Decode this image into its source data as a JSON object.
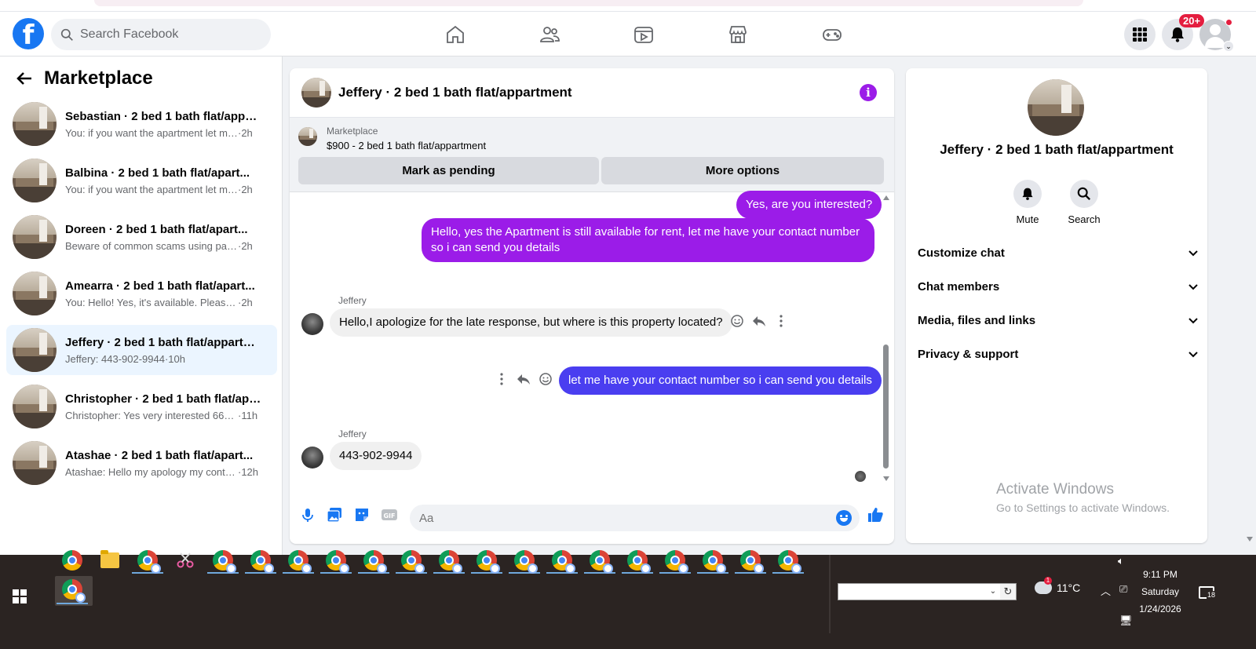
{
  "header": {
    "logo": "f",
    "search_placeholder": "Search Facebook",
    "notification_count": "20+"
  },
  "sidebar": {
    "title": "Marketplace",
    "conversations": [
      {
        "name": "Sebastian · 2 bed 1 bath flat/appar...",
        "snippet": "You: if you want the apartment let me...",
        "time": "·2h",
        "active": false
      },
      {
        "name": "Balbina · 2 bed 1 bath flat/apart...",
        "snippet": "You: if you want the apartment let me...",
        "time": "·2h",
        "active": false
      },
      {
        "name": "Doreen · 2 bed 1 bath flat/apart...",
        "snippet": "Beware of common scams using pay...",
        "time": "·2h",
        "active": false
      },
      {
        "name": "Amearra · 2 bed 1 bath flat/apart...",
        "snippet": "You: Hello! Yes, it's available. Please se...",
        "time": "·2h",
        "active": false
      },
      {
        "name": "Jeffery · 2 bed 1 bath flat/appartm...",
        "snippet": "Jeffery: 443-902-9944",
        "time": "·10h",
        "active": true
      },
      {
        "name": "Christopher · 2 bed 1 bath flat/app...",
        "snippet": "Christopher: Yes very interested 667...",
        "time": "·11h",
        "active": false
      },
      {
        "name": "Atashae · 2 bed 1 bath flat/apart...",
        "snippet": "Atashae: Hello my apology my conta...",
        "time": "·12h",
        "active": false
      }
    ]
  },
  "chat": {
    "title": "Jeffery · 2 bed 1 bath flat/appartment",
    "marketplace_label": "Marketplace",
    "listing": "$900 - 2 bed 1 bath flat/appartment",
    "mark_pending_label": "Mark as pending",
    "more_options_label": "More options",
    "messages": {
      "m1": "Yes, are you interested?",
      "m2": "Hello, yes the Apartment is still available for rent, let me have your contact number so i can send you details",
      "sender1": "Jeffery",
      "m3": "Hello,I apologize for the late response, but where is this property located?",
      "m4": "let me have your contact number so i can send you details",
      "sender2": "Jeffery",
      "m5": "443-902-9944"
    },
    "composer_placeholder": "Aa"
  },
  "info_panel": {
    "name": "Jeffery · 2 bed 1 bath flat/appartment",
    "mute_label": "Mute",
    "search_label": "Search",
    "sections": [
      "Customize chat",
      "Chat members",
      "Media, files and links",
      "Privacy & support"
    ],
    "watermark_title": "Activate Windows",
    "watermark_sub": "Go to Settings to activate Windows."
  },
  "taskbar": {
    "temperature": "11°C",
    "weather_badge": "1",
    "time": "9:11 PM",
    "day": "Saturday",
    "date": "1/24/2026",
    "notification_count": "18"
  }
}
